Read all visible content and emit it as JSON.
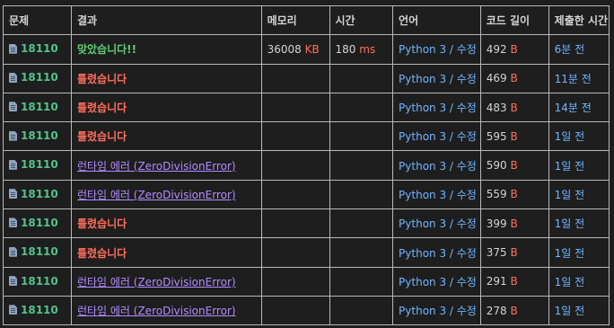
{
  "headers": {
    "problem": "문제",
    "result": "결과",
    "memory": "메모리",
    "time": "시간",
    "language": "언어",
    "code_length": "코드 길이",
    "submitted": "제출한 시간"
  },
  "colors": {
    "background": "#1e1e1e",
    "border": "#b9b9b9",
    "accepted": "#5fce74",
    "wrong": "#ff6e5a",
    "runtime_error": "#b38bff",
    "link_blue": "#6fb6ff",
    "problem_id": "#52c28a"
  },
  "rows": [
    {
      "problem": "18110",
      "result": "맞았습니다!!",
      "result_type": "accepted",
      "memory": "36008",
      "memory_unit": "KB",
      "time": "180",
      "time_unit": "ms",
      "language": "Python 3 / 수정",
      "length": "492",
      "length_unit": "B",
      "submitted": "6분 전"
    },
    {
      "problem": "18110",
      "result": "틀렸습니다",
      "result_type": "wrong",
      "memory": "",
      "memory_unit": "",
      "time": "",
      "time_unit": "",
      "language": "Python 3 / 수정",
      "length": "469",
      "length_unit": "B",
      "submitted": "11분 전"
    },
    {
      "problem": "18110",
      "result": "틀렸습니다",
      "result_type": "wrong",
      "memory": "",
      "memory_unit": "",
      "time": "",
      "time_unit": "",
      "language": "Python 3 / 수정",
      "length": "483",
      "length_unit": "B",
      "submitted": "14분 전"
    },
    {
      "problem": "18110",
      "result": "틀렸습니다",
      "result_type": "wrong",
      "memory": "",
      "memory_unit": "",
      "time": "",
      "time_unit": "",
      "language": "Python 3 / 수정",
      "length": "595",
      "length_unit": "B",
      "submitted": "1일 전"
    },
    {
      "problem": "18110",
      "result": "런타임 에러 (ZeroDivisionError)",
      "result_type": "runtime_error",
      "memory": "",
      "memory_unit": "",
      "time": "",
      "time_unit": "",
      "language": "Python 3 / 수정",
      "length": "590",
      "length_unit": "B",
      "submitted": "1일 전"
    },
    {
      "problem": "18110",
      "result": "런타임 에러 (ZeroDivisionError)",
      "result_type": "runtime_error",
      "memory": "",
      "memory_unit": "",
      "time": "",
      "time_unit": "",
      "language": "Python 3 / 수정",
      "length": "559",
      "length_unit": "B",
      "submitted": "1일 전"
    },
    {
      "problem": "18110",
      "result": "틀렸습니다",
      "result_type": "wrong",
      "memory": "",
      "memory_unit": "",
      "time": "",
      "time_unit": "",
      "language": "Python 3 / 수정",
      "length": "399",
      "length_unit": "B",
      "submitted": "1일 전"
    },
    {
      "problem": "18110",
      "result": "틀렸습니다",
      "result_type": "wrong",
      "memory": "",
      "memory_unit": "",
      "time": "",
      "time_unit": "",
      "language": "Python 3 / 수정",
      "length": "375",
      "length_unit": "B",
      "submitted": "1일 전"
    },
    {
      "problem": "18110",
      "result": "런타임 에러 (ZeroDivisionError)",
      "result_type": "runtime_error",
      "memory": "",
      "memory_unit": "",
      "time": "",
      "time_unit": "",
      "language": "Python 3 / 수정",
      "length": "291",
      "length_unit": "B",
      "submitted": "1일 전"
    },
    {
      "problem": "18110",
      "result": "런타임 에러 (ZeroDivisionError)",
      "result_type": "runtime_error",
      "memory": "",
      "memory_unit": "",
      "time": "",
      "time_unit": "",
      "language": "Python 3 / 수정",
      "length": "278",
      "length_unit": "B",
      "submitted": "1일 전"
    }
  ]
}
